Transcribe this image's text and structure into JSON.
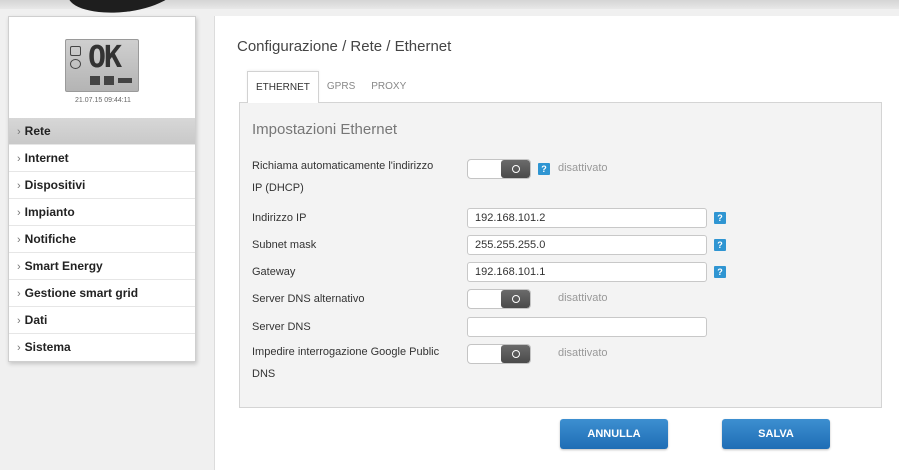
{
  "device": {
    "screen_text": "OK",
    "timestamp": "21.07.15 09:44:11"
  },
  "sidebar": {
    "items": [
      {
        "label": "Rete",
        "active": true
      },
      {
        "label": "Internet"
      },
      {
        "label": "Dispositivi"
      },
      {
        "label": "Impianto"
      },
      {
        "label": "Notifiche"
      },
      {
        "label": "Smart Energy"
      },
      {
        "label": "Gestione smart grid"
      },
      {
        "label": "Dati"
      },
      {
        "label": "Sistema"
      }
    ]
  },
  "main": {
    "breadcrumb": "Configurazione / Rete / Ethernet",
    "tabs": [
      {
        "label": "ETHERNET",
        "active": true
      },
      {
        "label": "GPRS"
      },
      {
        "label": "PROXY"
      }
    ],
    "panel_title": "Impostazioni Ethernet",
    "fields": {
      "dhcp": {
        "label_line1": "Richiama automaticamente l'indirizzo",
        "label_line2": "IP (DHCP)",
        "status": "disattivato"
      },
      "ip": {
        "label": "Indirizzo IP",
        "value": "192.168.101.2"
      },
      "subnet": {
        "label": "Subnet mask",
        "value": "255.255.255.0"
      },
      "gateway": {
        "label": "Gateway",
        "value": "192.168.101.1"
      },
      "alt_dns": {
        "label": "Server DNS alternativo",
        "status": "disattivato"
      },
      "dns_server": {
        "label": "Server DNS",
        "value": ""
      },
      "google_dns": {
        "label_line1": "Impedire interrogazione Google Public",
        "label_line2": "DNS",
        "status": "disattivato"
      }
    },
    "help_glyph": "?",
    "buttons": {
      "cancel": "ANNULLA",
      "save": "SALVA"
    }
  },
  "colors": {
    "accent": "#2f95d2",
    "button": "#2a7cc2",
    "active_menu": "#d0d0d0"
  }
}
